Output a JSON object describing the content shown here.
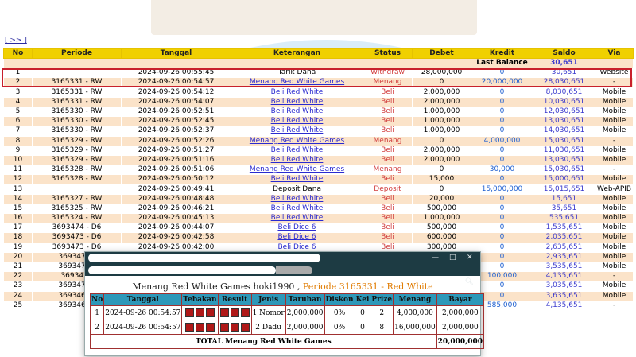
{
  "nav_link": "[ >> ]",
  "columns": [
    "No",
    "Periode",
    "Tanggal",
    "Keterangan",
    "Status",
    "Debet",
    "Kredit",
    "Saldo",
    "Via"
  ],
  "last_balance": {
    "label": "Last Balance",
    "value": "30,651"
  },
  "rows": [
    {
      "no": "1",
      "periode": "",
      "tanggal": "2024-09-26 00:55:45",
      "ket": "Tarik Dana",
      "status": "Withdraw",
      "debet": "28,000,000",
      "kredit": "0",
      "saldo": "30,651",
      "via": "Website"
    },
    {
      "no": "2",
      "periode": "3165331 - RW",
      "tanggal": "2024-09-26 00:54:57",
      "ket": "Menang Red White Games",
      "status": "Menang",
      "debet": "0",
      "kredit": "20,000,000",
      "saldo": "28,030,651",
      "via": "-"
    },
    {
      "no": "3",
      "periode": "3165331 - RW",
      "tanggal": "2024-09-26 00:54:12",
      "ket": "Beli Red White",
      "status": "Beli",
      "debet": "2,000,000",
      "kredit": "0",
      "saldo": "8,030,651",
      "via": "Mobile"
    },
    {
      "no": "4",
      "periode": "3165331 - RW",
      "tanggal": "2024-09-26 00:54:07",
      "ket": "Beli Red White",
      "status": "Beli",
      "debet": "2,000,000",
      "kredit": "0",
      "saldo": "10,030,651",
      "via": "Mobile"
    },
    {
      "no": "5",
      "periode": "3165330 - RW",
      "tanggal": "2024-09-26 00:52:51",
      "ket": "Beli Red White",
      "status": "Beli",
      "debet": "1,000,000",
      "kredit": "0",
      "saldo": "12,030,651",
      "via": "Mobile"
    },
    {
      "no": "6",
      "periode": "3165330 - RW",
      "tanggal": "2024-09-26 00:52:45",
      "ket": "Beli Red White",
      "status": "Beli",
      "debet": "1,000,000",
      "kredit": "0",
      "saldo": "13,030,651",
      "via": "Mobile"
    },
    {
      "no": "7",
      "periode": "3165330 - RW",
      "tanggal": "2024-09-26 00:52:37",
      "ket": "Beli Red White",
      "status": "Beli",
      "debet": "1,000,000",
      "kredit": "0",
      "saldo": "14,030,651",
      "via": "Mobile"
    },
    {
      "no": "8",
      "periode": "3165329 - RW",
      "tanggal": "2024-09-26 00:52:26",
      "ket": "Menang Red White Games",
      "status": "Menang",
      "debet": "0",
      "kredit": "4,000,000",
      "saldo": "15,030,651",
      "via": "-"
    },
    {
      "no": "9",
      "periode": "3165329 - RW",
      "tanggal": "2024-09-26 00:51:27",
      "ket": "Beli Red White",
      "status": "Beli",
      "debet": "2,000,000",
      "kredit": "0",
      "saldo": "11,030,651",
      "via": "Mobile"
    },
    {
      "no": "10",
      "periode": "3165329 - RW",
      "tanggal": "2024-09-26 00:51:16",
      "ket": "Beli Red White",
      "status": "Beli",
      "debet": "2,000,000",
      "kredit": "0",
      "saldo": "13,030,651",
      "via": "Mobile"
    },
    {
      "no": "11",
      "periode": "3165328 - RW",
      "tanggal": "2024-09-26 00:51:06",
      "ket": "Menang Red White Games",
      "status": "Menang",
      "debet": "0",
      "kredit": "30,000",
      "saldo": "15,030,651",
      "via": "-"
    },
    {
      "no": "12",
      "periode": "3165328 - RW",
      "tanggal": "2024-09-26 00:50:12",
      "ket": "Beli Red White",
      "status": "Beli",
      "debet": "15,000",
      "kredit": "0",
      "saldo": "15,000,651",
      "via": "Mobile"
    },
    {
      "no": "13",
      "periode": "",
      "tanggal": "2024-09-26 00:49:41",
      "ket": "Deposit Dana",
      "status": "Deposit",
      "debet": "0",
      "kredit": "15,000,000",
      "saldo": "15,015,651",
      "via": "Web-APIB"
    },
    {
      "no": "14",
      "periode": "3165327 - RW",
      "tanggal": "2024-09-26 00:48:48",
      "ket": "Beli Red White",
      "status": "Beli",
      "debet": "20,000",
      "kredit": "0",
      "saldo": "15,651",
      "via": "Mobile"
    },
    {
      "no": "15",
      "periode": "3165325 - RW",
      "tanggal": "2024-09-26 00:46:21",
      "ket": "Beli Red White",
      "status": "Beli",
      "debet": "500,000",
      "kredit": "0",
      "saldo": "35,651",
      "via": "Mobile"
    },
    {
      "no": "16",
      "periode": "3165324 - RW",
      "tanggal": "2024-09-26 00:45:13",
      "ket": "Beli Red White",
      "status": "Beli",
      "debet": "1,000,000",
      "kredit": "0",
      "saldo": "535,651",
      "via": "Mobile"
    },
    {
      "no": "17",
      "periode": "3693474 - D6",
      "tanggal": "2024-09-26 00:44:07",
      "ket": "Beli Dice 6",
      "status": "Beli",
      "debet": "500,000",
      "kredit": "0",
      "saldo": "1,535,651",
      "via": "Mobile"
    },
    {
      "no": "18",
      "periode": "3693473 - D6",
      "tanggal": "2024-09-26 00:42:58",
      "ket": "Beli Dice 6",
      "status": "Beli",
      "debet": "600,000",
      "kredit": "0",
      "saldo": "2,035,651",
      "via": "Mobile"
    },
    {
      "no": "19",
      "periode": "3693473 - D6",
      "tanggal": "2024-09-26 00:42:00",
      "ket": "Beli Dice 6",
      "status": "Beli",
      "debet": "300,000",
      "kredit": "0",
      "saldo": "2,635,651",
      "via": "Mobile"
    },
    {
      "no": "20",
      "periode": "3693472 -",
      "tanggal": "",
      "ket": "",
      "status": "",
      "debet": "",
      "kredit": "0",
      "saldo": "2,935,651",
      "via": "Mobile"
    },
    {
      "no": "21",
      "periode": "3693471 -",
      "tanggal": "",
      "ket": "",
      "status": "",
      "debet": "",
      "kredit": "0",
      "saldo": "3,535,651",
      "via": "Mobile"
    },
    {
      "no": "22",
      "periode": "3693470",
      "tanggal": "",
      "ket": "",
      "status": "",
      "debet": "",
      "kredit": "100,000",
      "saldo": "4,135,651",
      "via": "-"
    },
    {
      "no": "23",
      "periode": "3693470 -",
      "tanggal": "",
      "ket": "",
      "status": "",
      "debet": "",
      "kredit": "0",
      "saldo": "3,035,651",
      "via": "Mobile"
    },
    {
      "no": "24",
      "periode": "3693469 -",
      "tanggal": "",
      "ket": "",
      "status": "",
      "debet": "",
      "kredit": "0",
      "saldo": "3,635,651",
      "via": "Mobile"
    },
    {
      "no": "25",
      "periode": "3693468 -",
      "tanggal": "",
      "ket": "",
      "status": "",
      "debet": "",
      "kredit": "585,000",
      "saldo": "4,135,651",
      "via": "-"
    }
  ],
  "popup": {
    "title_main": "Menang Red White Games hoki1990 ,",
    "title_periode": "Periode 3165331 - Red White",
    "window_controls": [
      "—",
      "□",
      "✕"
    ],
    "columns": [
      "No",
      "Tanggal",
      "Tebakan",
      "Result",
      "Jenis",
      "Taruhan",
      "Diskon",
      "Kei",
      "Prize",
      "Menang",
      "Bayar"
    ],
    "rows": [
      {
        "no": "1",
        "tanggal": "2024-09-26 00:54:57",
        "jenis": "1 Nomor",
        "taruhan": "2,000,000",
        "diskon": "0%",
        "kei": "0",
        "prize": "2",
        "menang": "4,000,000",
        "bayar": "2,000,000"
      },
      {
        "no": "2",
        "tanggal": "2024-09-26 00:54:57",
        "jenis": "2 Dadu",
        "taruhan": "2,000,000",
        "diskon": "0%",
        "kei": "0",
        "prize": "8",
        "menang": "16,000,000",
        "bayar": "2,000,000"
      }
    ],
    "total_label": "TOTAL  Menang Red White Games",
    "total_value": "20,000,000"
  },
  "colors": {
    "header_yellow": "#f0d000",
    "row_peach": "#fbe3c9",
    "highlight_red": "#c8202c",
    "popup_header": "#2d98b9",
    "popup_bar": "#1d3b43"
  }
}
